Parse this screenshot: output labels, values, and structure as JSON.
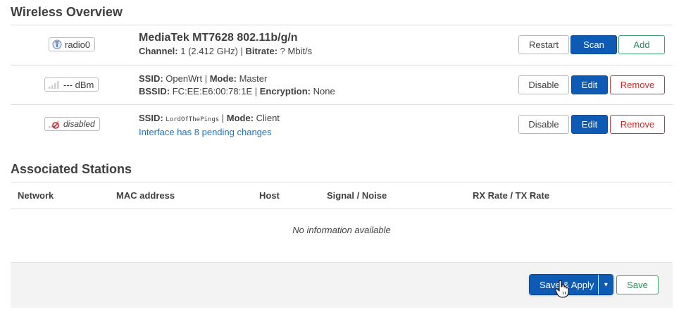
{
  "wireless": {
    "title": "Wireless Overview",
    "rows": [
      {
        "badge": "radio0",
        "badge_icon": "radio-icon",
        "title": "MediaTek MT7628 802.11b/g/n",
        "l2_k1": "Channel:",
        "l2_v1": "1 (2.412 GHz)",
        "l2_k2": "Bitrate:",
        "l2_v2": "? Mbit/s",
        "buttons": [
          "Restart",
          "Scan",
          "Add"
        ]
      },
      {
        "badge": "--- dBm",
        "badge_icon": "signal-icon",
        "l1_k1": "SSID:",
        "l1_v1": "OpenWrt",
        "l1_k2": "Mode:",
        "l1_v2": "Master",
        "l2_k1": "BSSID:",
        "l2_v1": "FC:EE:E6:00:78:1E",
        "l2_k2": "Encryption:",
        "l2_v2": "None",
        "buttons": [
          "Disable",
          "Edit",
          "Remove"
        ]
      },
      {
        "badge": "disabled",
        "badge_icon": "signal-disabled-icon",
        "l1_k1": "SSID:",
        "l1_v1": "LordOfThePings",
        "l1_k2": "Mode:",
        "l1_v2": "Client",
        "pending": "Interface has 8 pending changes",
        "buttons": [
          "Disable",
          "Edit",
          "Remove"
        ]
      }
    ]
  },
  "stations": {
    "title": "Associated Stations",
    "columns": [
      "Network",
      "MAC address",
      "Host",
      "Signal / Noise",
      "RX Rate / TX Rate"
    ],
    "empty": "No information available"
  },
  "footer": {
    "save_apply": "Save & Apply",
    "dropdown_glyph": "▾",
    "save": "Save"
  },
  "colors": {
    "primary": "#0d5bb4",
    "positive": "#2b8a56",
    "negative": "#c62d2d",
    "link": "#1a73c8"
  }
}
